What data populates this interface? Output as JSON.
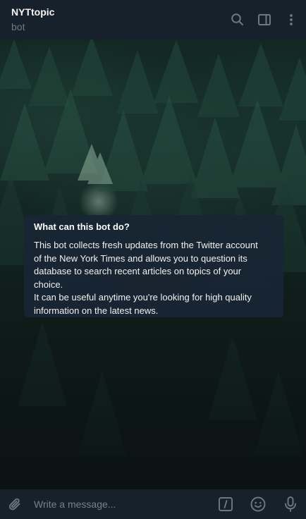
{
  "header": {
    "title": "NYTtopic",
    "subtitle": "bot",
    "icons": [
      "search-icon",
      "sidebar-toggle-icon",
      "more-vertical-icon"
    ]
  },
  "bot_info": {
    "title": "What can this bot do?",
    "description": "This bot collects fresh updates from the Twitter account\nof the New York Times and allows you to question its\ndatabase to search recent articles on topics of your\nchoice.\nIt can be useful anytime you're looking for high quality\ninformation on the latest news."
  },
  "composer": {
    "placeholder": "Write a message...",
    "value": "",
    "icons": [
      "attach-icon",
      "bot-commands-icon",
      "emoji-icon",
      "microphone-icon"
    ]
  },
  "colors": {
    "header_bg": "#17212b",
    "icon": "#6d7883",
    "card_bg": "#182533",
    "text": "#ffffff"
  }
}
